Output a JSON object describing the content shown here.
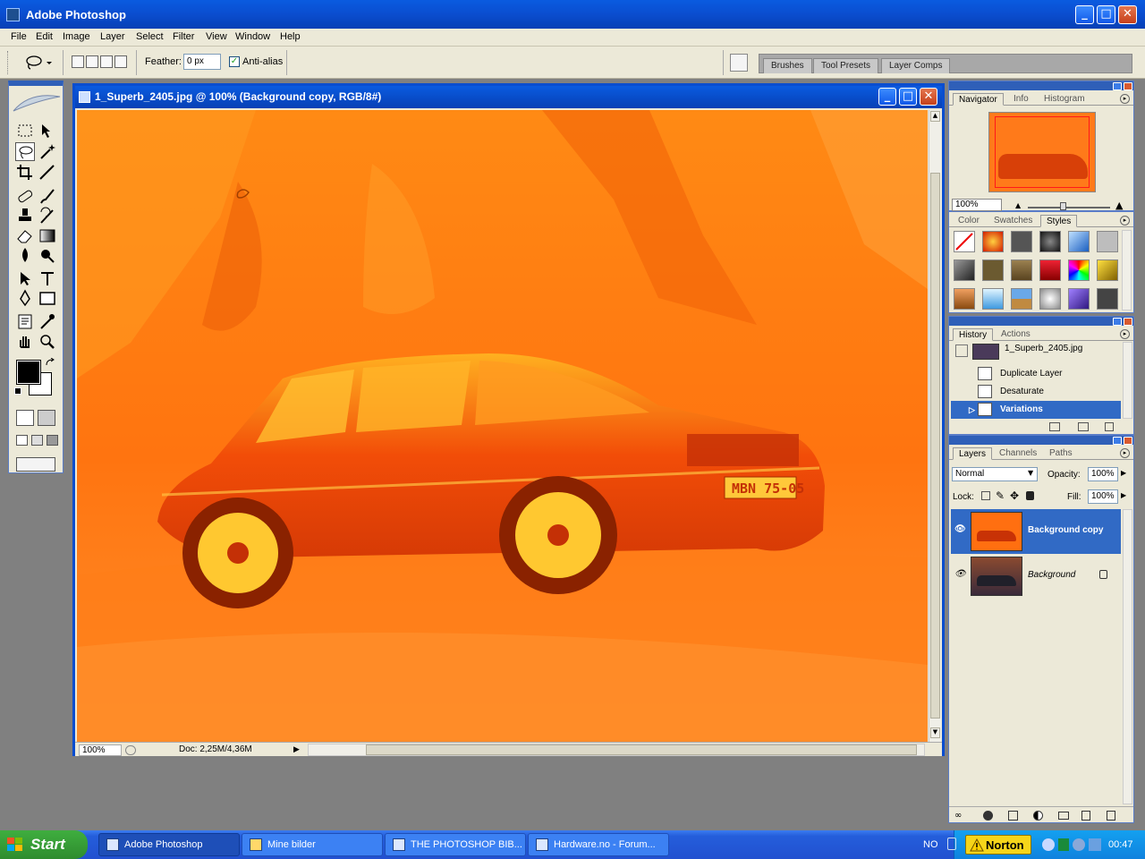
{
  "app": {
    "title": "Adobe Photoshop"
  },
  "menu": [
    "File",
    "Edit",
    "Image",
    "Layer",
    "Select",
    "Filter",
    "View",
    "Window",
    "Help"
  ],
  "options": {
    "feather_label": "Feather:",
    "feather_value": "0 px",
    "antialias_label": "Anti-alias",
    "antialias_checked": true
  },
  "palette_well": {
    "tabs": [
      "Brushes",
      "Tool Presets",
      "Layer Comps"
    ]
  },
  "document": {
    "title": "1_Superb_2405.jpg @ 100% (Background copy, RGB/8#)",
    "zoom": "100%",
    "doc_info": "Doc: 2,25M/4,36M",
    "plate": "MBN 75-05"
  },
  "navigator": {
    "tabs": [
      "Navigator",
      "Info",
      "Histogram"
    ],
    "zoom": "100%"
  },
  "styles": {
    "tabs": [
      "Color",
      "Swatches",
      "Styles"
    ]
  },
  "history": {
    "tabs": [
      "History",
      "Actions"
    ],
    "snapshot": "1_Superb_2405.jpg",
    "steps": [
      "Duplicate Layer",
      "Desaturate",
      "Variations"
    ],
    "active_step": "Variations"
  },
  "layers": {
    "tabs": [
      "Layers",
      "Channels",
      "Paths"
    ],
    "blend_mode": "Normal",
    "opacity_label": "Opacity:",
    "opacity": "100%",
    "lock_label": "Lock:",
    "fill_label": "Fill:",
    "fill": "100%",
    "items": [
      {
        "name": "Background copy",
        "active": true
      },
      {
        "name": "Background",
        "active": false
      }
    ]
  },
  "taskbar": {
    "start": "Start",
    "tasks": [
      "Adobe Photoshop",
      "Mine bilder",
      "THE PHOTOSHOP BIB...",
      "Hardware.no - Forum..."
    ],
    "language": "NO",
    "norton": "Norton",
    "clock": "00:47"
  },
  "colors": {
    "xp_blue": "#0a4dcf",
    "canvas_orange": "#ff7a12",
    "selection_blue": "#316ac5"
  }
}
